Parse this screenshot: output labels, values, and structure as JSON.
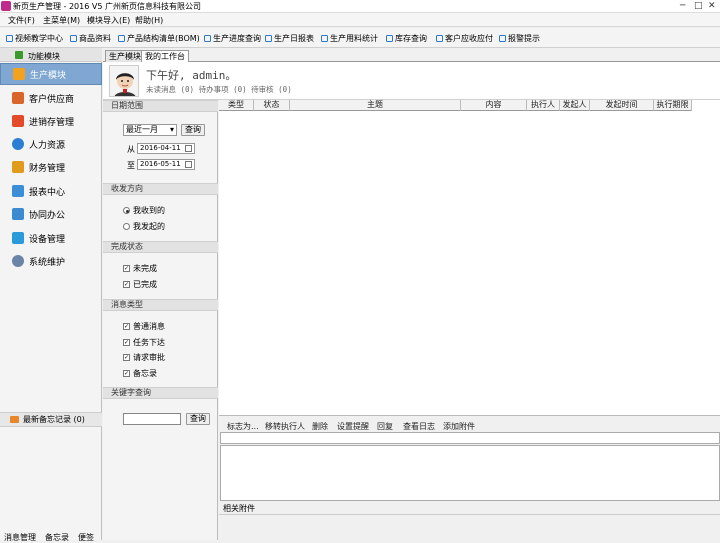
{
  "window": {
    "title": "新页生产管理 - 2016 V5 广州新页信息科技有限公司",
    "controls": [
      "─",
      "□",
      "✕"
    ]
  },
  "menu": [
    "文件(F)",
    "主菜单(M)",
    "模块导入(E)",
    "帮助(H)"
  ],
  "quickbar": [
    "视频教学中心",
    "商品资料",
    "产品结构清单(BOM)",
    "生产进度查询",
    "生产日报表",
    "生产用料统计",
    "库存查询",
    "客户应收应付",
    "报警提示"
  ],
  "sidebar": {
    "header": "功能模块",
    "modules": [
      {
        "label": "生产模块",
        "icon": "folder-icon",
        "color": "#f2a21e",
        "active": true
      },
      {
        "label": "客户供应商",
        "icon": "people-icon",
        "color": "#d9652b"
      },
      {
        "label": "进销存管理",
        "icon": "bar-chart-icon",
        "color": "#e24a2a"
      },
      {
        "label": "人力资源",
        "icon": "person-icon",
        "color": "#2a7fd4"
      },
      {
        "label": "财务管理",
        "icon": "money-icon",
        "color": "#e09a1c"
      },
      {
        "label": "报表中心",
        "icon": "report-icon",
        "color": "#3b8fd6"
      },
      {
        "label": "协同办公",
        "icon": "office-icon",
        "color": "#3c8bd0"
      },
      {
        "label": "设备管理",
        "icon": "device-icon",
        "color": "#2b9ad8"
      },
      {
        "label": "系统维护",
        "icon": "gear-icon",
        "color": "#6a84a8"
      }
    ],
    "memo": "最新备忘记录 (0)",
    "bottom_tabs": [
      "消息管理",
      "备忘录",
      "便签"
    ]
  },
  "tabs": [
    "生产模块",
    "我的工作台"
  ],
  "greeting": {
    "text": "下午好, admin。",
    "stats": "未读消息 (0)  待办事项 (0)  待审核 (0)"
  },
  "filters": {
    "date_range": {
      "title": "日期范围",
      "period": "最近一月",
      "query": "查询",
      "from_label": "从",
      "from": "2016-04-11",
      "to_label": "至",
      "to": "2016-05-11"
    },
    "direction": {
      "title": "收发方向",
      "options": [
        {
          "label": "我收到的",
          "checked": true
        },
        {
          "label": "我发起的",
          "checked": false
        }
      ]
    },
    "status": {
      "title": "完成状态",
      "options": [
        {
          "label": "未完成",
          "checked": true
        },
        {
          "label": "已完成",
          "checked": true
        }
      ]
    },
    "msg_type": {
      "title": "消息类型",
      "options": [
        {
          "label": "普通消息",
          "checked": true
        },
        {
          "label": "任务下达",
          "checked": true
        },
        {
          "label": "请求审批",
          "checked": true
        },
        {
          "label": "备忘录",
          "checked": true
        }
      ]
    },
    "keyword": {
      "title": "关键字查询",
      "value": "",
      "query": "查询"
    }
  },
  "grid": {
    "columns": [
      "类型",
      "状态",
      "主题",
      "内容",
      "执行人",
      "发起人",
      "发起时间",
      "执行期限"
    ]
  },
  "detail": {
    "actions": [
      "标志为...",
      "移转执行人",
      "删除",
      "设置提醒",
      "回复",
      "查看日志",
      "添加附件"
    ],
    "attachments_label": "相关附件"
  }
}
